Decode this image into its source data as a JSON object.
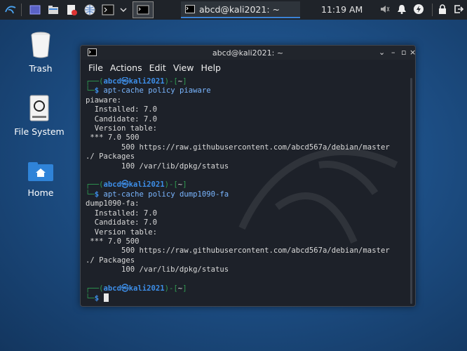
{
  "panel": {
    "task_title": "abcd@kali2021: ~",
    "clock": "11:19 AM"
  },
  "desktop": {
    "trash_label": "Trash",
    "filesystem_label": "File System",
    "home_label": "Home"
  },
  "window": {
    "title": "abcd@kali2021: ~",
    "menu": [
      "File",
      "Actions",
      "Edit",
      "View",
      "Help"
    ]
  },
  "terminal": {
    "prompt_user": "abcd",
    "prompt_at": "㉿",
    "prompt_host": "kali2021",
    "prompt_dir": "~",
    "blocks": [
      {
        "command": "apt-cache policy piaware",
        "output": [
          "piaware:",
          "  Installed: 7.0",
          "  Candidate: 7.0",
          "  Version table:",
          " *** 7.0 500",
          "        500 https://raw.githubusercontent.com/abcd567a/debian/master",
          "./ Packages",
          "        100 /var/lib/dpkg/status"
        ]
      },
      {
        "command": "apt-cache policy dump1090-fa",
        "output": [
          "dump1090-fa:",
          "  Installed: 7.0",
          "  Candidate: 7.0",
          "  Version table:",
          " *** 7.0 500",
          "        500 https://raw.githubusercontent.com/abcd567a/debian/master",
          "./ Packages",
          "        100 /var/lib/dpkg/status"
        ]
      }
    ]
  }
}
